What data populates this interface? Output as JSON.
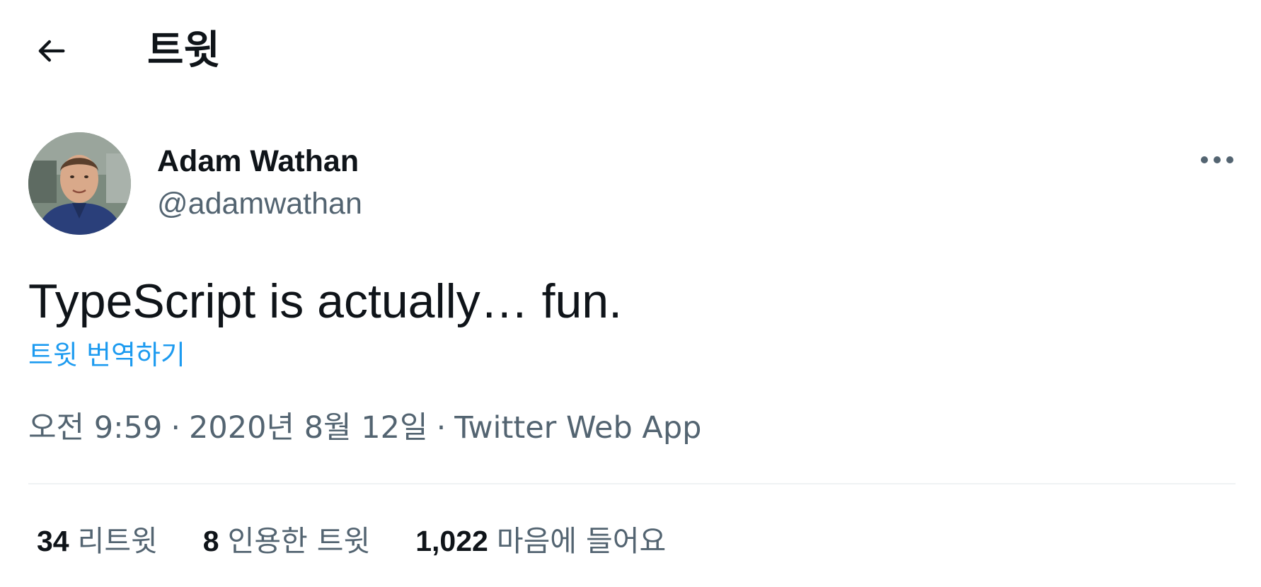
{
  "header": {
    "back_icon": "arrow-left-icon",
    "title": "트윗"
  },
  "author": {
    "avatar_icon": "avatar-photo",
    "name": "Adam Wathan",
    "handle": "@adamwathan",
    "more_icon": "more-horizontal-icon"
  },
  "tweet": {
    "text": "TypeScript is actually… fun.",
    "translate_label": "트윗 번역하기"
  },
  "meta": {
    "time": "오전 9:59",
    "separator": "·",
    "date": "2020년 8월 12일",
    "source": "Twitter Web App"
  },
  "stats": [
    {
      "count": "34",
      "label": "리트윗"
    },
    {
      "count": "8",
      "label": "인용한 트윗"
    },
    {
      "count": "1,022",
      "label": "마음에 들어요"
    }
  ],
  "colors": {
    "text_primary": "#0f1419",
    "text_secondary": "#536471",
    "link": "#1d9bf0",
    "divider": "#eff3f4"
  }
}
